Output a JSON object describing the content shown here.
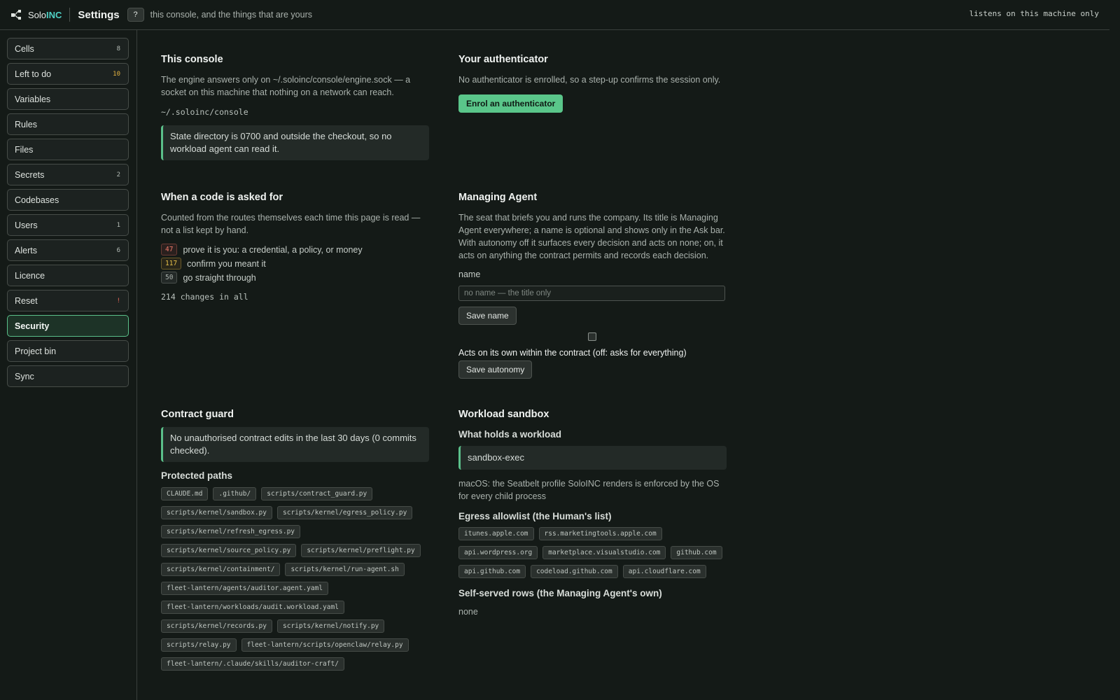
{
  "topbar": {
    "brand_solo": "Solo",
    "brand_inc": "INC",
    "title": "Settings",
    "help_label": "?",
    "subtitle": "this console, and the things that are yours",
    "right_status": "listens on this machine only"
  },
  "sidebar": {
    "items": [
      {
        "label": "Cells",
        "count": "8"
      },
      {
        "label": "Left to do",
        "count": "10"
      },
      {
        "label": "Variables",
        "count": ""
      },
      {
        "label": "Rules",
        "count": ""
      },
      {
        "label": "Files",
        "count": ""
      },
      {
        "label": "Secrets",
        "count": "2"
      },
      {
        "label": "Codebases",
        "count": ""
      },
      {
        "label": "Users",
        "count": "1"
      },
      {
        "label": "Alerts",
        "count": "6"
      },
      {
        "label": "Licence",
        "count": ""
      },
      {
        "label": "Reset",
        "count": "!"
      },
      {
        "label": "Security",
        "count": ""
      },
      {
        "label": "Project bin",
        "count": ""
      },
      {
        "label": "Sync",
        "count": ""
      }
    ],
    "active": "Security"
  },
  "console": {
    "title": "This console",
    "desc": "The engine answers only on ~/.soloinc/console/engine.sock — a socket on this machine that nothing on a network can reach.",
    "path": "~/.soloinc/console",
    "callout": "State directory is 0700 and outside the checkout, so no workload agent can read it."
  },
  "authenticator": {
    "title": "Your authenticator",
    "desc": "No authenticator is enrolled, so a step-up confirms the session only.",
    "button": "Enrol an authenticator"
  },
  "codes": {
    "title": "When a code is asked for",
    "desc": "Counted from the routes themselves each time this page is read — not a list kept by hand.",
    "routes": [
      {
        "count": "47",
        "text": "prove it is you: a credential, a policy, or money"
      },
      {
        "count": "117",
        "text": "confirm you meant it"
      },
      {
        "count": "50",
        "text": "go straight through"
      }
    ],
    "total": "214 changes in all"
  },
  "managing_agent": {
    "title": "Managing Agent",
    "desc": "The seat that briefs you and runs the company. Its title is Managing Agent everywhere; a name is optional and shows only in the Ask bar. With autonomy off it surfaces every decision and acts on none; on, it acts on anything the contract permits and records each decision.",
    "name_label": "name",
    "name_placeholder": "no name — the title only",
    "save_name": "Save name",
    "autonomy_label": "Acts on its own within the contract (off: asks for everything)",
    "save_autonomy": "Save autonomy"
  },
  "contract": {
    "title": "Contract guard",
    "callout": "No unauthorised contract edits in the last 30 days (0 commits checked).",
    "protected_title": "Protected paths",
    "paths": [
      "CLAUDE.md",
      ".github/",
      "scripts/contract_guard.py",
      "scripts/kernel/sandbox.py",
      "scripts/kernel/egress_policy.py",
      "scripts/kernel/refresh_egress.py",
      "scripts/kernel/source_policy.py",
      "scripts/kernel/preflight.py",
      "scripts/kernel/containment/",
      "scripts/kernel/run-agent.sh",
      "fleet-lantern/agents/auditor.agent.yaml",
      "fleet-lantern/workloads/audit.workload.yaml",
      "scripts/kernel/records.py",
      "scripts/kernel/notify.py",
      "scripts/relay.py",
      "fleet-lantern/scripts/openclaw/relay.py",
      "fleet-lantern/.claude/skills/auditor-craft/"
    ]
  },
  "sandbox": {
    "title": "Workload sandbox",
    "holds_title": "What holds a workload",
    "holder": "sandbox-exec",
    "holder_desc": "macOS: the Seatbelt profile SoloINC renders is enforced by the OS for every child process",
    "egress_title": "Egress allowlist (the Human's list)",
    "egress": [
      "itunes.apple.com",
      "rss.marketingtools.apple.com",
      "api.wordpress.org",
      "marketplace.visualstudio.com",
      "github.com",
      "api.github.com",
      "codeload.github.com",
      "api.cloudflare.com"
    ],
    "self_title": "Self-served rows (the Managing Agent's own)",
    "self_value": "none"
  },
  "colors": {
    "accent": "#5bc08a",
    "brand_inc": "#4fd1c5",
    "warn": "#e3b341",
    "alert": "#ef6a5a"
  }
}
